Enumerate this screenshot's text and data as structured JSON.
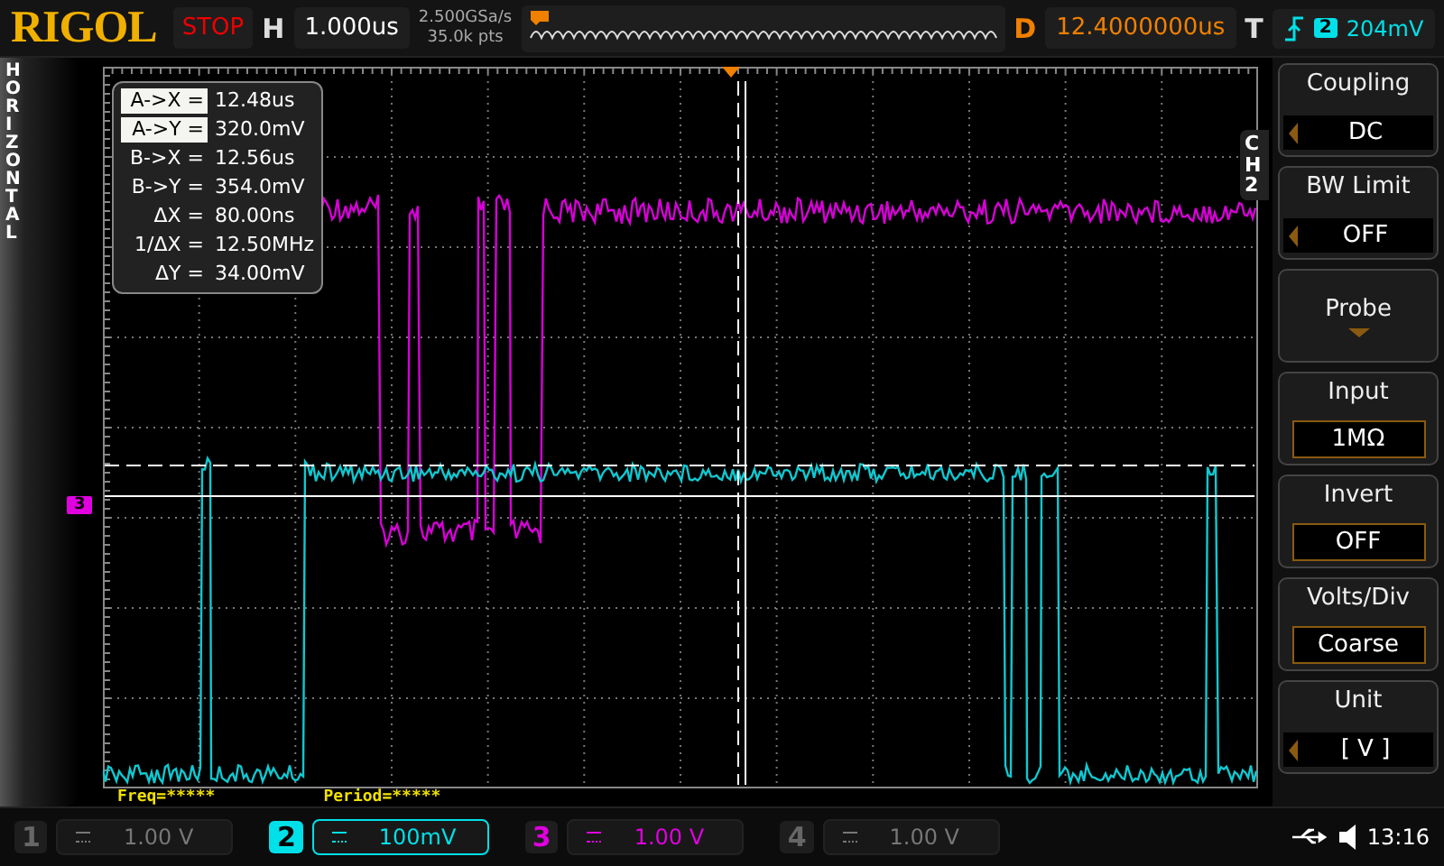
{
  "header": {
    "brand": "RIGOL",
    "run_state": "STOP",
    "timebase_label": "H",
    "timebase": "1.000us",
    "sample_rate": "2.500GSa/s",
    "memory_depth": "35.0k pts",
    "delay_label": "D",
    "delay": "12.4000000us",
    "trigger_label": "T",
    "trigger_channel": "2",
    "trigger_level": "204mV"
  },
  "side_label": "HORIZONTAL",
  "cursor_readout": [
    {
      "label": "A->X =",
      "value": "12.48us",
      "highlighted": true
    },
    {
      "label": "A->Y =",
      "value": "320.0mV",
      "highlighted": true
    },
    {
      "label": "B->X =",
      "value": "12.56us",
      "highlighted": false
    },
    {
      "label": "B->Y =",
      "value": "354.0mV",
      "highlighted": false
    },
    {
      "label": "ΔX =",
      "value": "80.00ns",
      "highlighted": false
    },
    {
      "label": "1/ΔX =",
      "value": "12.50MHz",
      "highlighted": false
    },
    {
      "label": "ΔY =",
      "value": "34.00mV",
      "highlighted": false
    }
  ],
  "channel_marker": "3",
  "measurements": [
    "Freq=*****",
    "Period=*****"
  ],
  "menu": {
    "title": "CH2",
    "items": [
      {
        "kind": "option",
        "label": "Coupling",
        "value": "DC"
      },
      {
        "kind": "option",
        "label": "BW Limit",
        "value": "OFF"
      },
      {
        "kind": "submenu",
        "label": "Probe"
      },
      {
        "kind": "field",
        "label": "Input",
        "value": "1MΩ"
      },
      {
        "kind": "field",
        "label": "Invert",
        "value": "OFF"
      },
      {
        "kind": "field",
        "label": "Volts/Div",
        "value": "Coarse"
      },
      {
        "kind": "option",
        "label": "Unit",
        "value": "[  V  ]"
      }
    ]
  },
  "channels": [
    {
      "number": "1",
      "scale": "1.00 V",
      "enabled": false,
      "selected": false
    },
    {
      "number": "2",
      "scale": "100mV",
      "enabled": true,
      "selected": true,
      "color": "#00e0e8"
    },
    {
      "number": "3",
      "scale": "1.00 V",
      "enabled": true,
      "selected": false,
      "color": "#e000e0"
    },
    {
      "number": "4",
      "scale": "1.00 V",
      "enabled": false,
      "selected": false
    }
  ],
  "clock": "13:16"
}
